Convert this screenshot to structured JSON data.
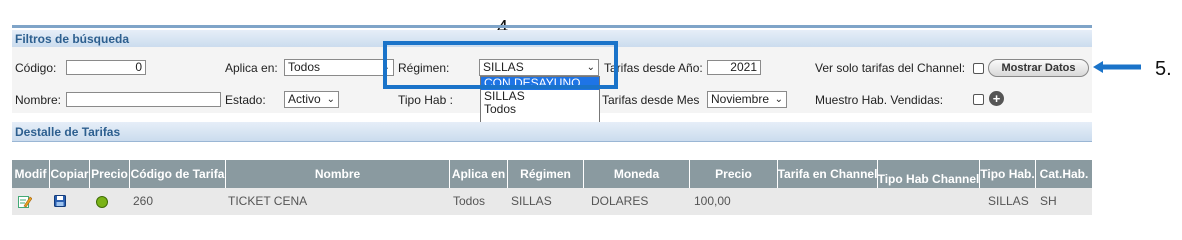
{
  "annotations": {
    "step4": "4.",
    "step5": "5."
  },
  "filters": {
    "title": "Filtros de búsqueda",
    "codigo_label": "Código:",
    "codigo_value": "0",
    "aplica_label": "Aplica en:",
    "aplica_value": "Todos",
    "regimen_label": "Régimen:",
    "regimen_value": "SILLAS",
    "regimen_options": [
      "CON DESAYUNO",
      "SILLAS",
      "Todos"
    ],
    "tarifas_anio_label": "Tarifas desde Año:",
    "tarifas_anio_value": "2021",
    "channel_label": "Ver solo tarifas del Channel:",
    "mostrar_button": "Mostrar Datos",
    "nombre_label": "Nombre:",
    "nombre_value": "",
    "estado_label": "Estado:",
    "estado_value": "Activo",
    "tipo_hab_label": "Tipo Hab :",
    "tarifas_mes_label": "Tarifas desde Mes",
    "tarifas_mes_value": "Noviembre",
    "muestro_label": "Muestro Hab. Vendidas:"
  },
  "detalle": {
    "title": "Destalle de Tarifas",
    "headers": [
      "Modif",
      "Copiar",
      "Precio",
      "Código de Tarifa",
      "Nombre",
      "Aplica en",
      "Régimen",
      "Moneda",
      "Precio",
      "Tarifa en Channel",
      "Tipo Hab Channel",
      "Tipo Hab.",
      "Cat.Hab."
    ],
    "rows": [
      {
        "codigo": "260",
        "nombre": "TICKET CENA",
        "aplica": "Todos",
        "regimen": "SILLAS",
        "moneda": "DOLARES",
        "precio": "100,00",
        "tarifa_channel": "",
        "tipo_hab_channel": "",
        "tipo_hab": "SILLAS",
        "cat_hab": "SH"
      }
    ]
  },
  "colors": {
    "accent": "#1a73c9",
    "header_bg": "#8a9aa0",
    "section_text": "#2d5f8f"
  }
}
